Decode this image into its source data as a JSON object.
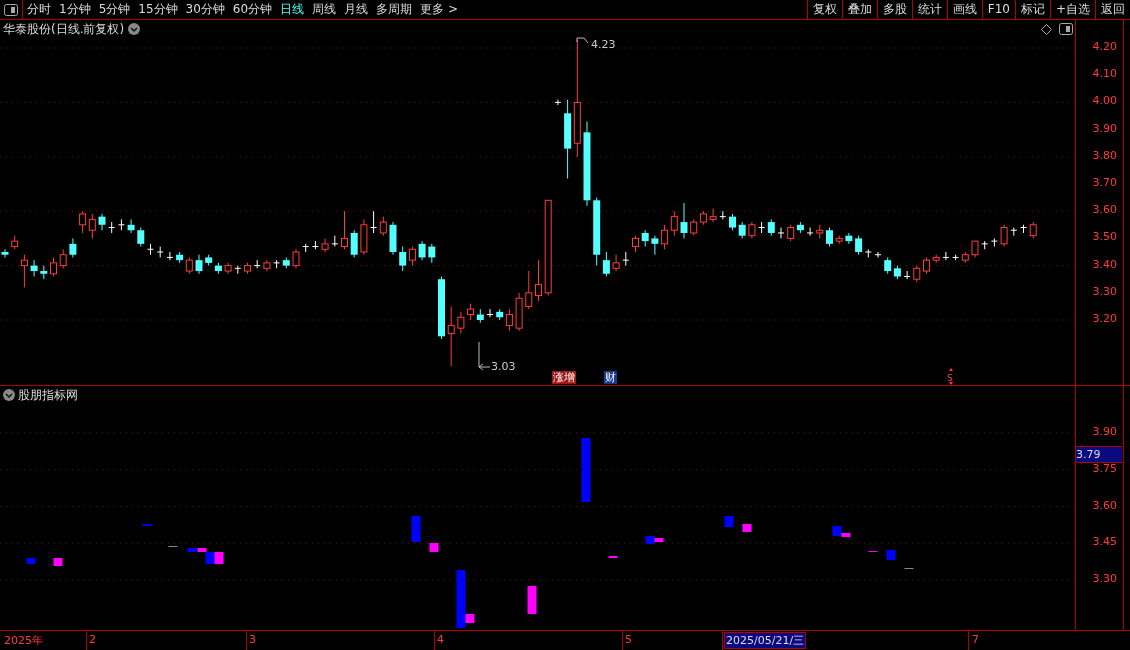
{
  "toolbar": {
    "periods": [
      {
        "label": "分时",
        "selected": false
      },
      {
        "label": "1分钟",
        "selected": false
      },
      {
        "label": "5分钟",
        "selected": false
      },
      {
        "label": "15分钟",
        "selected": false
      },
      {
        "label": "30分钟",
        "selected": false
      },
      {
        "label": "60分钟",
        "selected": false
      },
      {
        "label": "日线",
        "selected": true
      },
      {
        "label": "周线",
        "selected": false
      },
      {
        "label": "月线",
        "selected": false
      },
      {
        "label": "多周期",
        "selected": false
      },
      {
        "label": "更多 >",
        "selected": false
      }
    ],
    "actions": [
      "复权",
      "叠加",
      "多股",
      "统计",
      "画线",
      "F10",
      "标记",
      "+自选",
      "返回"
    ]
  },
  "price_chart": {
    "title": "华泰股份(日线.前复权)",
    "axis_labels": [
      "4.20",
      "4.10",
      "4.00",
      "3.90",
      "3.80",
      "3.70",
      "3.60",
      "3.50",
      "3.40",
      "3.30",
      "3.20"
    ],
    "high_label": "4.23",
    "low_label": "3.03",
    "event_tags": [
      {
        "text": "涨增",
        "color": "#a01818"
      },
      {
        "text": "财",
        "color": "#1a3a8a"
      },
      {
        "text": "S",
        "color": "#000000"
      }
    ]
  },
  "indicator": {
    "title": "股朋指标网",
    "axis_labels": [
      "3.90",
      "3.75",
      "3.60",
      "3.45",
      "3.30"
    ],
    "cursor_value": "3.79"
  },
  "date_axis": {
    "labels": [
      "2025年",
      "2",
      "3",
      "4",
      "5",
      "7"
    ],
    "cursor_date": "2025/05/21/三"
  }
}
